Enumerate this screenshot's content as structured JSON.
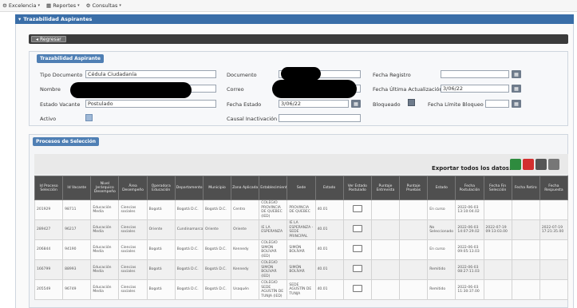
{
  "menu": [
    {
      "label": "Excelencia",
      "icon": "gear-icon"
    },
    {
      "label": "Reportes",
      "icon": "grid-icon"
    },
    {
      "label": "Consultas",
      "icon": "gear-icon"
    }
  ],
  "title": "Trazabilidad Aspirantes",
  "back_label": "Regresar",
  "aspirant_section": {
    "header": "Trazabilidad Aspirante",
    "fields": {
      "tipo_documento": {
        "label": "Tipo Documento",
        "value": "Cédula Ciudadanía"
      },
      "nombre": {
        "label": "Nombre",
        "value": ""
      },
      "estado_vacante": {
        "label": "Estado Vacante",
        "value": "Postulado"
      },
      "activo": {
        "label": "Activo",
        "checked": true
      },
      "documento": {
        "label": "Documento",
        "value": ""
      },
      "correo": {
        "label": "Correo",
        "value": ""
      },
      "fecha_estado": {
        "label": "Fecha Estado",
        "value": "3/06/22"
      },
      "causal_inactivacion": {
        "label": "Causal Inactivación",
        "value": ""
      },
      "fecha_registro": {
        "label": "Fecha Registro",
        "value": ""
      },
      "fecha_ultima_actualizacion": {
        "label": "Fecha Última Actualización",
        "value": "3/06/22"
      },
      "bloqueado": {
        "label": "Bloqueado",
        "checked": false
      },
      "fecha_limite_bloqueo": {
        "label": "Fecha Límite Bloqueo",
        "value": ""
      }
    }
  },
  "process_section": {
    "header": "Procesos de Selección",
    "export_label": "Exportar todos los datos:",
    "columns": [
      "Id Proceso Selección",
      "Id Vacante",
      "Nivel Jerárquico Desempeño",
      "Área Desempeño",
      "Operadora Educación",
      "Departamento",
      "Municipio",
      "Zona Aplicada",
      "Establecimiento",
      "Sede",
      "Estado",
      "Ver Estado Postulado",
      "Puntaje Entrevista",
      "Puntaje Pruebas",
      "Estado",
      "Fecha Postulación",
      "Fecha Fin Selección",
      "Fecha Retiro",
      "Fecha Respuesta"
    ],
    "rows": [
      {
        "cells": [
          "201929",
          "98711",
          "Educación Media",
          "Ciencias sociales",
          "Bogotá",
          "Bogotá D.C.",
          "Bogotá D.C.",
          "Centro",
          "COLEGIO PROVINCIA DE QUEBEC (IED)",
          "PROVINCIA DE QUEBEC",
          "40.01",
          "",
          "",
          "",
          "En curso",
          "2022-06-03\n13:10:04.02",
          "",
          "",
          ""
        ]
      },
      {
        "cells": [
          "289427",
          "96217",
          "Educación Media",
          "Ciencias sociales",
          "Oriente",
          "Cundinamarca",
          "Oriente",
          "Oriente",
          "IE LA ESPERANZA",
          "IE LA ESPERANZA - SEDE PRINCIPAL",
          "40.01",
          "",
          "",
          "",
          "No Seleccionado",
          "2022-06-03\n14:07:29.02",
          "2022-07-19\n09:13:03.00",
          "",
          "2022-07-19\n17:21:35.00"
        ]
      },
      {
        "cells": [
          "206844",
          "94190",
          "Educación Media",
          "Ciencias sociales",
          "Bogotá",
          "Bogotá D.C.",
          "Bogotá D.C.",
          "Kennedy",
          "COLEGIO SIMÓN BOLÍVAR (IED)",
          "SIMÓN BOLÍVAR",
          "40.01",
          "",
          "",
          "",
          "En curso",
          "2022-06-03\n09:05:13.03",
          "",
          "",
          ""
        ]
      },
      {
        "cells": [
          "166799",
          "88993",
          "Educación Media",
          "Ciencias sociales",
          "Bogotá",
          "Bogotá D.C.",
          "Bogotá D.C.",
          "Kennedy",
          "COLEGIO SIMÓN BOLÍVAR (IED)",
          "SIMÓN BOLÍVAR",
          "40.01",
          "",
          "",
          "",
          "Remitido",
          "2022-06-03\n08:27:11.03",
          "",
          "",
          ""
        ]
      },
      {
        "cells": [
          "205549",
          "96749",
          "Educación Media",
          "Ciencias sociales",
          "Bogotá",
          "Bogotá D.C.",
          "Bogotá D.C.",
          "Usaquén",
          "COLEGIO SEDE AGUSTÍN DE TUNJA (IED)",
          "SEDE AGUSTÍN DE TUNJA",
          "40.01",
          "",
          "",
          "",
          "Remitido",
          "2022-06-03\n11:30:37.00",
          "",
          "",
          ""
        ]
      }
    ]
  },
  "colors": {
    "title_bar": "#3a6ea8",
    "section_header": "#4f7fb4",
    "table_header": "#4f4f4f",
    "back_bar": "#3b3b3b"
  },
  "export_icons": [
    "excel-export-icon",
    "pdf-export-icon",
    "print-icon",
    "printer-alt-icon"
  ]
}
